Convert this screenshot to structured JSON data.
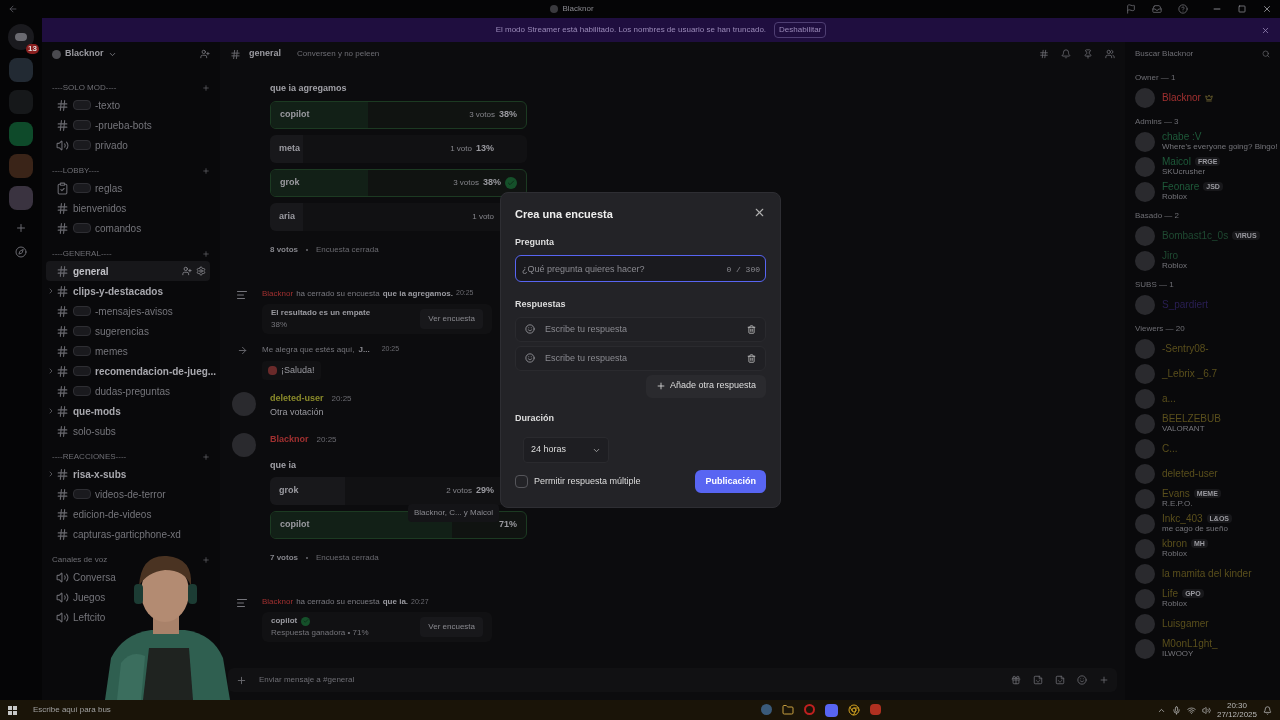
{
  "window": {
    "title": "Blacknor"
  },
  "banner": {
    "text": "El modo Streamer está habilitado. Los nombres de usuario se han truncado.",
    "button": "Deshabilitar"
  },
  "rail": {
    "badge": "13"
  },
  "server": {
    "name": "Blacknor"
  },
  "categories": [
    {
      "name": "----SOLO MOD----",
      "channels": [
        {
          "name": "-texto",
          "kind": "text",
          "tag": true,
          "unread": false,
          "selected": false,
          "thread": false
        },
        {
          "name": "-prueba-bots",
          "kind": "text",
          "tag": true,
          "unread": false,
          "selected": false,
          "thread": false
        },
        {
          "name": "privado",
          "kind": "voice",
          "tag": true,
          "unread": false,
          "selected": false,
          "thread": false
        }
      ]
    },
    {
      "name": "----LOBBY----",
      "channels": [
        {
          "name": "reglas",
          "kind": "rules",
          "tag": true,
          "unread": false,
          "selected": false,
          "thread": false
        },
        {
          "name": "bienvenidos",
          "kind": "text",
          "tag": false,
          "unread": false,
          "selected": false,
          "thread": false
        },
        {
          "name": "comandos",
          "kind": "text",
          "tag": true,
          "unread": false,
          "selected": false,
          "thread": false
        }
      ]
    },
    {
      "name": "----GENERAL----",
      "channels": [
        {
          "name": "general",
          "kind": "text",
          "tag": false,
          "unread": true,
          "selected": true,
          "thread": false
        },
        {
          "name": "clips-y-destacados",
          "kind": "text",
          "tag": false,
          "unread": true,
          "selected": false,
          "thread": true
        },
        {
          "name": "-mensajes-avisos",
          "kind": "text",
          "tag": true,
          "unread": false,
          "selected": false,
          "thread": false
        },
        {
          "name": "sugerencias",
          "kind": "text",
          "tag": true,
          "unread": false,
          "selected": false,
          "thread": false
        },
        {
          "name": "memes",
          "kind": "text",
          "tag": true,
          "unread": false,
          "selected": false,
          "thread": false
        },
        {
          "name": "recomendacion-de-jueg...",
          "kind": "text",
          "tag": true,
          "unread": true,
          "selected": false,
          "thread": true
        },
        {
          "name": "dudas-preguntas",
          "kind": "text",
          "tag": true,
          "unread": false,
          "selected": false,
          "thread": false
        },
        {
          "name": "que-mods",
          "kind": "text",
          "tag": false,
          "unread": true,
          "selected": false,
          "thread": true
        },
        {
          "name": "solo-subs",
          "kind": "text",
          "tag": false,
          "unread": false,
          "selected": false,
          "thread": false
        }
      ]
    },
    {
      "name": "----REACCIONES----",
      "channels": [
        {
          "name": "risa-x-subs",
          "kind": "text",
          "tag": false,
          "unread": true,
          "selected": false,
          "thread": true
        },
        {
          "name": "videos-de-terror",
          "kind": "text",
          "tag": true,
          "unread": false,
          "selected": false,
          "thread": false
        },
        {
          "name": "edicion-de-videos",
          "kind": "text",
          "tag": false,
          "unread": false,
          "selected": false,
          "thread": false
        },
        {
          "name": "capturas-garticphone-xd",
          "kind": "text",
          "tag": false,
          "unread": false,
          "selected": false,
          "thread": false
        }
      ]
    },
    {
      "name": "Canales de voz",
      "channels": [
        {
          "name": "Conversa",
          "kind": "voice",
          "tag": false,
          "unread": false,
          "selected": false,
          "thread": false
        },
        {
          "name": "Juegos",
          "kind": "voice",
          "tag": false,
          "unread": false,
          "selected": false,
          "thread": false
        },
        {
          "name": "Leftcito",
          "kind": "voice",
          "tag": false,
          "unread": false,
          "selected": false,
          "thread": false
        }
      ]
    }
  ],
  "channel_header": {
    "name": "general",
    "topic": "Conversen y no peleen"
  },
  "messages": [
    {
      "kind": "poll",
      "poll": {
        "question": "que ia agregamos",
        "options": [
          {
            "label": "copilot",
            "votes": "3 votos",
            "percent": "38%",
            "level": 0.38,
            "winner": true,
            "voted": false
          },
          {
            "label": "meta",
            "votes": "1 voto",
            "percent": "13%",
            "level": 0.13,
            "winner": false,
            "voted": false
          },
          {
            "label": "grok",
            "votes": "3 votos",
            "percent": "38%",
            "level": 0.38,
            "winner": true,
            "voted": true
          },
          {
            "label": "aria",
            "votes": "1 voto",
            "level": 0.13,
            "winner": false,
            "voted": false
          }
        ],
        "total": "8 votos",
        "status": "Encuesta cerrada"
      }
    },
    {
      "kind": "poll_closed",
      "author": "Blacknor",
      "action": "ha cerrado su encuesta",
      "poll_name": "que ia agregamos.",
      "time": "20:25",
      "result": "El resultado es un empate",
      "detail": "38%",
      "button": "Ver encuesta",
      "winner": false
    },
    {
      "kind": "welcome",
      "text": "Me alegra que estés aquí,",
      "name": "J...",
      "time": "20:25",
      "button": "¡Saluda!"
    },
    {
      "kind": "message",
      "author": "deleted-user",
      "color": "#8a8a2a",
      "time": "20:25",
      "text": "Otra votación"
    },
    {
      "kind": "poll",
      "author": "Blacknor",
      "color": "#a03030",
      "time": "20:25",
      "poll": {
        "question": "que ia",
        "options": [
          {
            "label": "grok",
            "votes": "2 votos",
            "percent": "29%",
            "level": 0.29,
            "winner": false,
            "voted": false
          },
          {
            "label": "copilot",
            "percent": "71%",
            "level": 0.71,
            "winner": true,
            "voted": false
          }
        ],
        "total": "7 votos",
        "status": "Encuesta cerrada"
      }
    },
    {
      "kind": "poll_closed",
      "author": "Blacknor",
      "action": "ha cerrado su encuesta",
      "poll_name": "que ia.",
      "time": "20:27",
      "result": "copilot",
      "detail": "Respuesta ganadora • 71%",
      "button": "Ver encuesta",
      "winner": true
    }
  ],
  "tooltip": "Blacknor, C... y Maicol",
  "composer": {
    "placeholder": "Enviar mensaje a #general"
  },
  "members": {
    "search": "Buscar Blacknor",
    "groups": [
      {
        "title": "Owner — 1",
        "members": [
          {
            "name": "Blacknor",
            "color": "#a03030",
            "crown": true
          }
        ]
      },
      {
        "title": "Admins — 3",
        "members": [
          {
            "name": "chabe :V",
            "color": "#1e5a3a",
            "activity": "Where's everyone going? Bingo!"
          },
          {
            "name": "Maicol",
            "color": "#1e5a3a",
            "tag": "FRGE",
            "activity": "SKUcrusher"
          },
          {
            "name": "Feonare",
            "color": "#1e5a3a",
            "tag": "JSD",
            "activity": "Roblox"
          }
        ]
      },
      {
        "title": "Basado — 2",
        "members": [
          {
            "name": "Bombast1c_0s",
            "color": "#1f4a32",
            "tag": "VIRUS"
          },
          {
            "name": "Jiro",
            "color": "#1f4a32",
            "activity": "Roblox"
          }
        ]
      },
      {
        "title": "SUBS — 1",
        "members": [
          {
            "name": "S_pardiert",
            "color": "#2a1f55"
          }
        ]
      },
      {
        "title": "Viewers — 20",
        "members": [
          {
            "name": "-Sentry08-",
            "color": "#5a4f1c"
          },
          {
            "name": "_Lebrix _6.7",
            "color": "#5a4f1c"
          },
          {
            "name": "a...",
            "color": "#5a4f1c"
          },
          {
            "name": "BEELZEBUB",
            "color": "#5a4f1c",
            "activity": "VALORANT"
          },
          {
            "name": "C...",
            "color": "#5a4f1c"
          },
          {
            "name": "deleted-user",
            "color": "#5a4f1c"
          },
          {
            "name": "Evans",
            "color": "#5a4f1c",
            "tag": "MEME",
            "activity": "R.E.P.O."
          },
          {
            "name": "Inkc_403",
            "color": "#5a4f1c",
            "tag": "L&OS",
            "activity": "me cago de sueño"
          },
          {
            "name": "kbron",
            "color": "#5a4f1c",
            "tag": "MH",
            "activity": "Roblox"
          },
          {
            "name": "la mamita del kinder",
            "color": "#5a4f1c"
          },
          {
            "name": "Life",
            "color": "#5a4f1c",
            "tag": "GPO",
            "activity": "Roblox"
          },
          {
            "name": "Luisgamer",
            "color": "#5a4f1c"
          },
          {
            "name": "M0onL1ght_",
            "color": "#5a4f1c",
            "activity": "ILWOOY"
          }
        ]
      }
    ]
  },
  "modal": {
    "title": "Crea una encuesta",
    "question_label": "Pregunta",
    "question_placeholder": "¿Qué pregunta quieres hacer?",
    "counter": "0 / 300",
    "answers_label": "Respuestas",
    "answers": [
      {
        "placeholder": "Escribe tu respuesta"
      },
      {
        "placeholder": "Escribe tu respuesta"
      }
    ],
    "add_button": "Añade otra respuesta",
    "duration_label": "Duración",
    "duration": "24 horas",
    "multiple": {
      "label": "Permitir respuesta múltiple",
      "checked": false
    },
    "submit": "Publicación"
  },
  "taskbar": {
    "search": "Escribe aquí para bus",
    "time": "20:30",
    "date": "27/12/2025"
  }
}
